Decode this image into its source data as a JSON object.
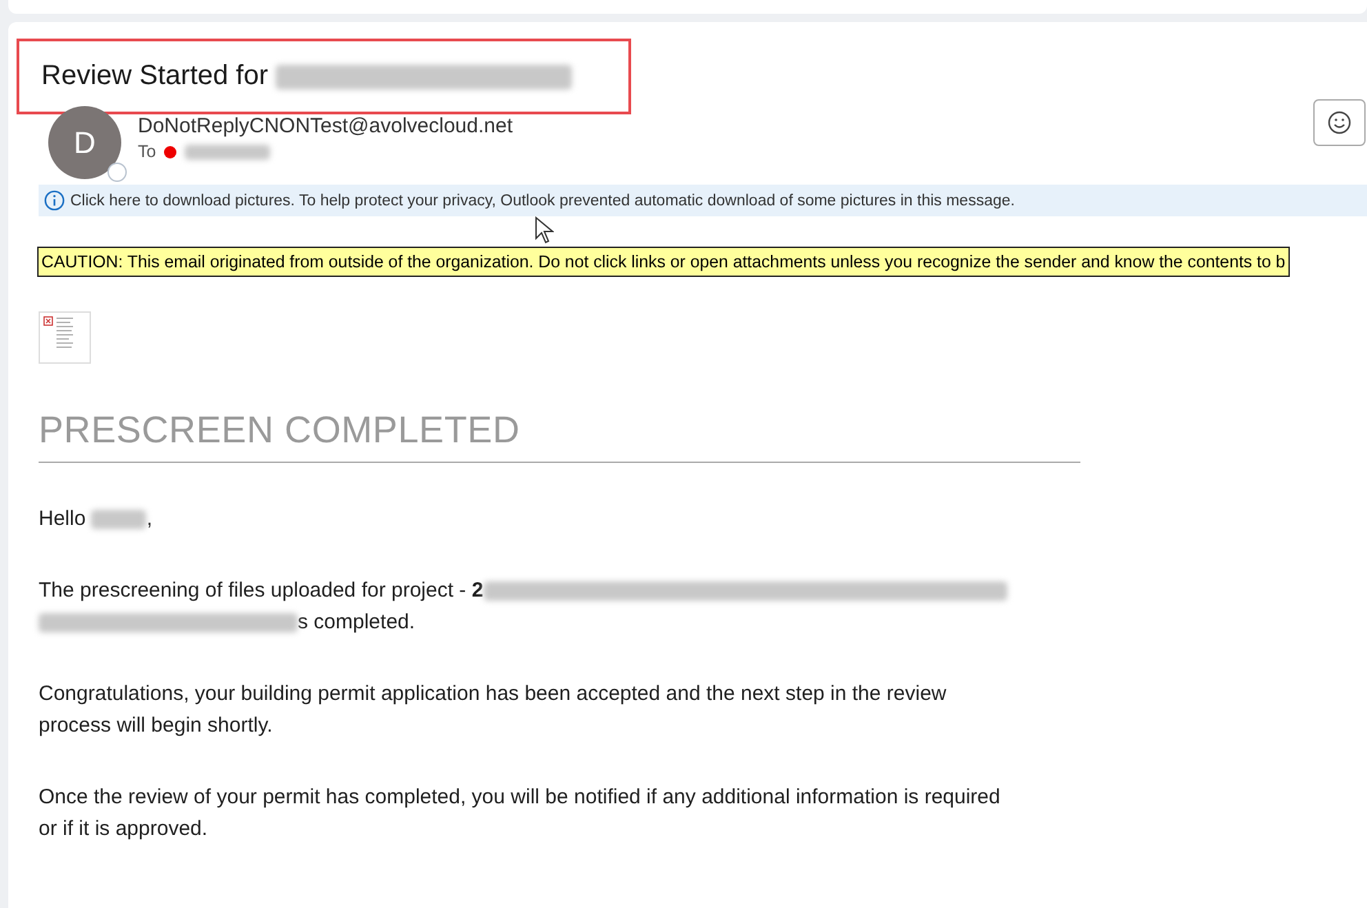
{
  "subject": {
    "text": "Review Started for",
    "redacted": true,
    "highlighted": true
  },
  "sender": {
    "avatar_letter": "D",
    "address": "DoNotReplyCNONTest@avolvecloud.net",
    "to_label": "To",
    "recipient_redacted": true
  },
  "info_bar": {
    "text": "Click here to download pictures. To help protect your privacy, Outlook prevented automatic download of some pictures in this message."
  },
  "caution": {
    "text": "CAUTION: This email originated from outside of the organization. Do not click links or open attachments unless you recognize the sender and know the contents to b"
  },
  "body": {
    "heading": "PRESCREEN COMPLETED",
    "paragraphs": [
      {
        "parts": [
          {
            "kind": "text",
            "text": "Hello "
          },
          {
            "kind": "redacted"
          },
          {
            "kind": "text",
            "text": ","
          }
        ]
      },
      {
        "parts": [
          {
            "kind": "text",
            "text": "The prescreening of files uploaded for project - **2**"
          },
          {
            "kind": "redacted"
          },
          {
            "kind": "redacted"
          },
          {
            "kind": "text",
            "text": "s completed."
          }
        ]
      },
      {
        "parts": [
          {
            "kind": "text",
            "text": "Congratulations, your building permit application has been accepted and the next step in the review process will begin shortly."
          }
        ]
      },
      {
        "parts": [
          {
            "kind": "text",
            "text": "Once the review of your permit has completed, you will be notified if any additional information is required or if it is approved."
          }
        ]
      }
    ]
  }
}
